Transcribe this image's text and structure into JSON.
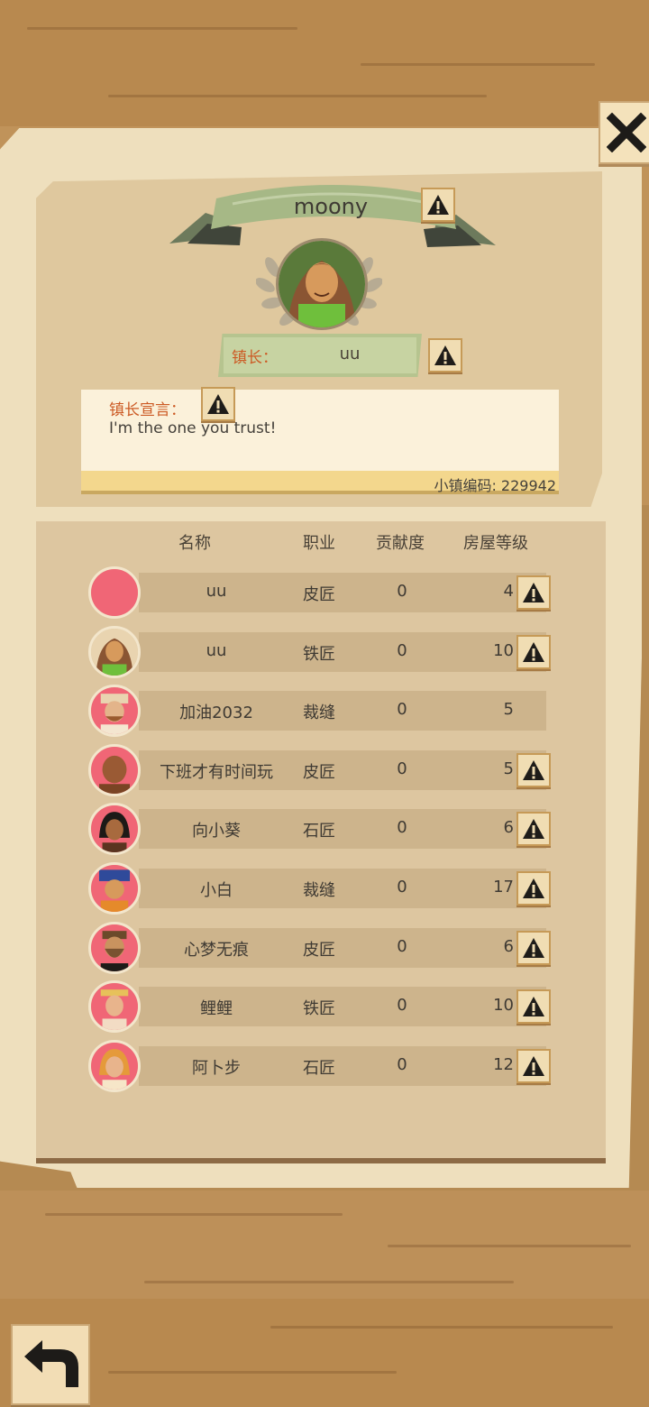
{
  "header": {
    "town_name": "moony",
    "mayor_label": "镇长：",
    "mayor_name": "uu",
    "manifesto_label": "镇长宣言：",
    "manifesto_text": "I'm the one you trust!",
    "town_code": "小镇编码: 229942"
  },
  "table": {
    "columns": [
      "名称",
      "职业",
      "贡献度",
      "房屋等级"
    ],
    "rows": [
      {
        "name": "uu",
        "job": "皮匠",
        "contribution": "0",
        "house_level": "4",
        "report": true,
        "avatar": "pink-circle"
      },
      {
        "name": "uu",
        "job": "铁匠",
        "contribution": "0",
        "house_level": "10",
        "report": true,
        "avatar": "curly-hair-woman"
      },
      {
        "name": "加油2032",
        "job": "裁缝",
        "contribution": "0",
        "house_level": "5",
        "report": false,
        "avatar": "cap-man"
      },
      {
        "name": "下班才有时间玩",
        "job": "皮匠",
        "contribution": "0",
        "house_level": "5",
        "report": true,
        "avatar": "bald-man"
      },
      {
        "name": "向小葵",
        "job": "石匠",
        "contribution": "0",
        "house_level": "6",
        "report": true,
        "avatar": "dark-hair-woman"
      },
      {
        "name": "小白",
        "job": "裁缝",
        "contribution": "0",
        "house_level": "17",
        "report": true,
        "avatar": "blue-hat-man"
      },
      {
        "name": "心梦无痕",
        "job": "皮匠",
        "contribution": "0",
        "house_level": "6",
        "report": true,
        "avatar": "bearded-man"
      },
      {
        "name": "鲤鲤",
        "job": "铁匠",
        "contribution": "0",
        "house_level": "10",
        "report": true,
        "avatar": "headband-woman"
      },
      {
        "name": "阿卜步",
        "job": "石匠",
        "contribution": "0",
        "house_level": "12",
        "report": true,
        "avatar": "orange-hair-girl"
      }
    ]
  },
  "icons": {
    "close": "close-icon",
    "back": "back-arrow-icon",
    "report": "warning-icon"
  },
  "colors": {
    "accent_label": "#cc5a24",
    "row_bar": "#cdb48c",
    "ribbon": "#a6b886"
  }
}
